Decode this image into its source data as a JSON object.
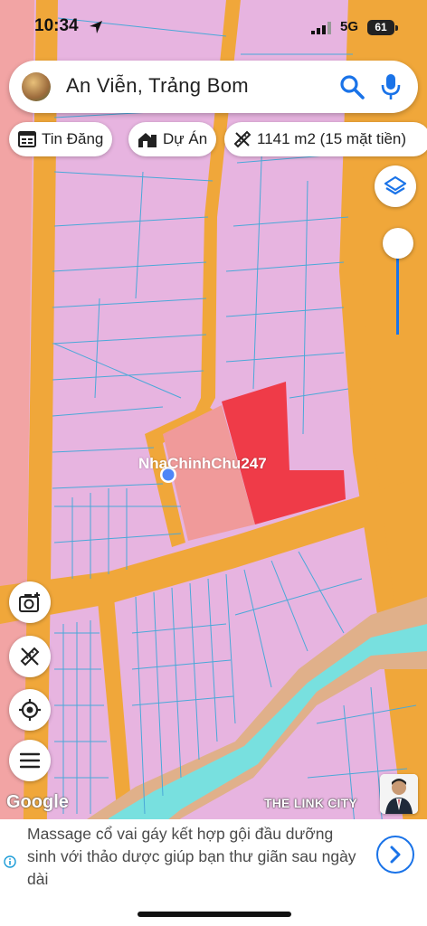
{
  "status_bar": {
    "time": "10:34",
    "network": "5G",
    "battery": "61"
  },
  "search": {
    "query": "An Viễn, Trảng Bom"
  },
  "chips": [
    {
      "label": "Tin Đăng",
      "icon": "newspaper-icon"
    },
    {
      "label": "Dự Án",
      "icon": "buildings-icon"
    },
    {
      "label": "1141 m2 (15 mặt tiền)",
      "icon": "measure-icon"
    }
  ],
  "map": {
    "watermark": "NhaChinhChu247",
    "attribution": "Google",
    "brand": "THE LINK CITY",
    "colors": {
      "residential": "#e7b4e0",
      "road": "#f0a73a",
      "parcel_line": "#4aa8d8",
      "selected_parcel": "#ef3b48",
      "highlight_parcel": "#f09a9a",
      "river": "#78e0df",
      "agricultural": "#f2a4a4"
    },
    "controls": [
      "layers-icon",
      "camera-icon",
      "measure-tool-icon",
      "my-location-icon",
      "menu-icon"
    ]
  },
  "ad": {
    "text": "Massage cổ vai gáy kết hợp gội đầu dưỡng sinh với thảo dược giúp bạn thư giãn sau ngày dài"
  }
}
